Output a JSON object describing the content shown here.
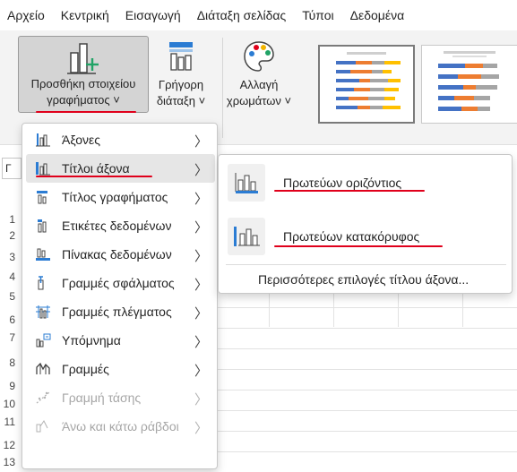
{
  "menu_tabs": [
    "Αρχείο",
    "Κεντρική",
    "Εισαγωγή",
    "Διάταξη σελίδας",
    "Τύποι",
    "Δεδομένα"
  ],
  "ribbon": {
    "add_chart_element": {
      "line1": "Προσθήκη στοιχείου",
      "line2": "γραφήματος ˅"
    },
    "quick_layout": {
      "line1": "Γρήγορη",
      "line2": "διάταξη ˅"
    },
    "change_colors": {
      "line1": "Αλλαγή",
      "line2": "χρωμάτων ˅"
    }
  },
  "sheet": {
    "name_box": "Γ",
    "rows": [
      "1",
      "2",
      "3",
      "4",
      "5",
      "6",
      "7",
      "8",
      "9",
      "10",
      "11",
      "12",
      "13"
    ]
  },
  "dropdown": {
    "items": [
      {
        "label": "Άξονες",
        "icon": "axes-icon",
        "disabled": false
      },
      {
        "label": "Τίτλοι άξονα",
        "icon": "axis-titles-icon",
        "disabled": false,
        "active": true
      },
      {
        "label": "Τίτλος γραφήματος",
        "icon": "chart-title-icon",
        "disabled": false
      },
      {
        "label": "Ετικέτες δεδομένων",
        "icon": "data-labels-icon",
        "disabled": false
      },
      {
        "label": "Πίνακας δεδομένων",
        "icon": "data-table-icon",
        "disabled": false
      },
      {
        "label": "Γραμμές σφάλματος",
        "icon": "error-bars-icon",
        "disabled": false
      },
      {
        "label": "Γραμμές πλέγματος",
        "icon": "gridlines-icon",
        "disabled": false
      },
      {
        "label": "Υπόμνημα",
        "icon": "legend-icon",
        "disabled": false
      },
      {
        "label": "Γραμμές",
        "icon": "lines-icon",
        "disabled": false
      },
      {
        "label": "Γραμμή τάσης",
        "icon": "trendline-icon",
        "disabled": true
      },
      {
        "label": "Άνω και κάτω ράβδοι",
        "icon": "up-down-bars-icon",
        "disabled": true
      }
    ]
  },
  "submenu": {
    "primary_horizontal": "Πρωτεύων οριζόντιος",
    "primary_vertical": "Πρωτεύων κατακόρυφος",
    "more_options": "Περισσότερες επιλογές τίτλου άξονα..."
  },
  "colors": {
    "accent_red": "#e0001b",
    "green": "#21a366",
    "blue": "#2b7cd3"
  }
}
